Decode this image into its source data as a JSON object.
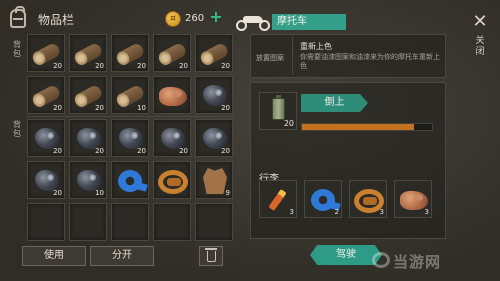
{
  "inventory": {
    "title": "物品栏",
    "coins": "260",
    "add_symbol": "+",
    "section_top_label": "背包",
    "section_bottom_label": "背包",
    "slots_top": [
      {
        "item": "log",
        "qty": "20"
      },
      {
        "item": "log",
        "qty": "20"
      },
      {
        "item": "log",
        "qty": "20"
      },
      {
        "item": "log",
        "qty": "20"
      },
      {
        "item": "log",
        "qty": "20"
      },
      {
        "item": "log",
        "qty": "20"
      },
      {
        "item": "log",
        "qty": "20"
      },
      {
        "item": "log",
        "qty": "10"
      },
      {
        "item": "rock",
        "qty": ""
      },
      {
        "item": "ore",
        "qty": "20"
      }
    ],
    "slots_bottom": [
      {
        "item": "ore",
        "qty": "20"
      },
      {
        "item": "ore",
        "qty": "20"
      },
      {
        "item": "ore",
        "qty": "20"
      },
      {
        "item": "ore",
        "qty": "20"
      },
      {
        "item": "ore",
        "qty": "20"
      },
      {
        "item": "ore",
        "qty": "20"
      },
      {
        "item": "ore",
        "qty": "10"
      },
      {
        "item": "tape",
        "qty": ""
      },
      {
        "item": "rope",
        "qty": ""
      },
      {
        "item": "hide",
        "qty": "9"
      },
      {
        "item": "",
        "qty": ""
      },
      {
        "item": "",
        "qty": ""
      },
      {
        "item": "",
        "qty": ""
      },
      {
        "item": "",
        "qty": ""
      },
      {
        "item": "",
        "qty": ""
      }
    ],
    "use_label": "使用",
    "split_label": "分开"
  },
  "vehicle": {
    "title": "摩托车",
    "close_symbol": "✕",
    "close_label": "关闭",
    "info_slot_label": "放置图案",
    "info_name": "重新上色",
    "info_desc": "你需要油漆图案和油漆来为你的摩托车重新上色",
    "paint_qty": "20",
    "pour_label": "倒上",
    "paint_progress": 0.86,
    "luggage_label": "行李",
    "luggage": [
      {
        "item": "flare",
        "qty": "3"
      },
      {
        "item": "tape",
        "qty": "2"
      },
      {
        "item": "rope",
        "qty": "3"
      },
      {
        "item": "rock",
        "qty": "3"
      }
    ],
    "drive_label": "驾驶"
  },
  "watermark": "当游网",
  "colors": {
    "accent": "#35a08a",
    "progress": "#c4711f",
    "coin": "#e0a93a",
    "add": "#39b98e"
  }
}
